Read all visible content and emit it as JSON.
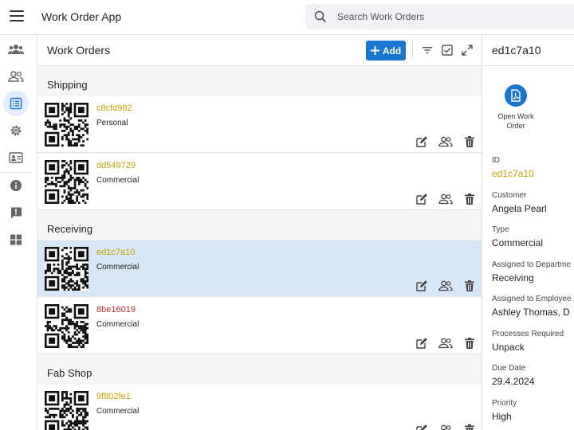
{
  "app": {
    "title": "Work Order App"
  },
  "search": {
    "placeholder": "Search Work Orders"
  },
  "list": {
    "title": "Work Orders",
    "add_label": "Add",
    "groups": [
      {
        "label": "Shipping",
        "orders": [
          {
            "id": "c8cfd982",
            "type": "Personal",
            "id_color": "#c9a200"
          },
          {
            "id": "dd549729",
            "type": "Commercial",
            "id_color": "#c9a200"
          }
        ]
      },
      {
        "label": "Receiving",
        "orders": [
          {
            "id": "ed1c7a10",
            "type": "Commercial",
            "id_color": "#c9a200",
            "selected": true
          },
          {
            "id": "8be16019",
            "type": "Commercial",
            "id_color": "#c62828"
          }
        ]
      },
      {
        "label": "Fab Shop",
        "orders": [
          {
            "id": "9f802fe1",
            "type": "Commercial",
            "id_color": "#c9a200"
          }
        ]
      }
    ]
  },
  "detail": {
    "title": "ed1c7a10",
    "open_label": "Open Work Order",
    "fields": [
      {
        "label": "ID",
        "value": "ed1c7a10",
        "link": true
      },
      {
        "label": "Customer",
        "value": "Angela Pearl"
      },
      {
        "label": "Type",
        "value": "Commercial"
      },
      {
        "label": "Assigned to Departme",
        "value": "Receiving"
      },
      {
        "label": "Assigned to Employee",
        "value": "Ashley Thomas, D"
      },
      {
        "label": "Processes Required",
        "value": "Unpack"
      },
      {
        "label": "Due Date",
        "value": "29.4.2024"
      },
      {
        "label": "Priority",
        "value": "High"
      }
    ]
  },
  "colors": {
    "accent": "#1976d2",
    "selected_row": "#d6e6f7",
    "id_gold": "#c9a200",
    "id_red": "#c62828"
  }
}
